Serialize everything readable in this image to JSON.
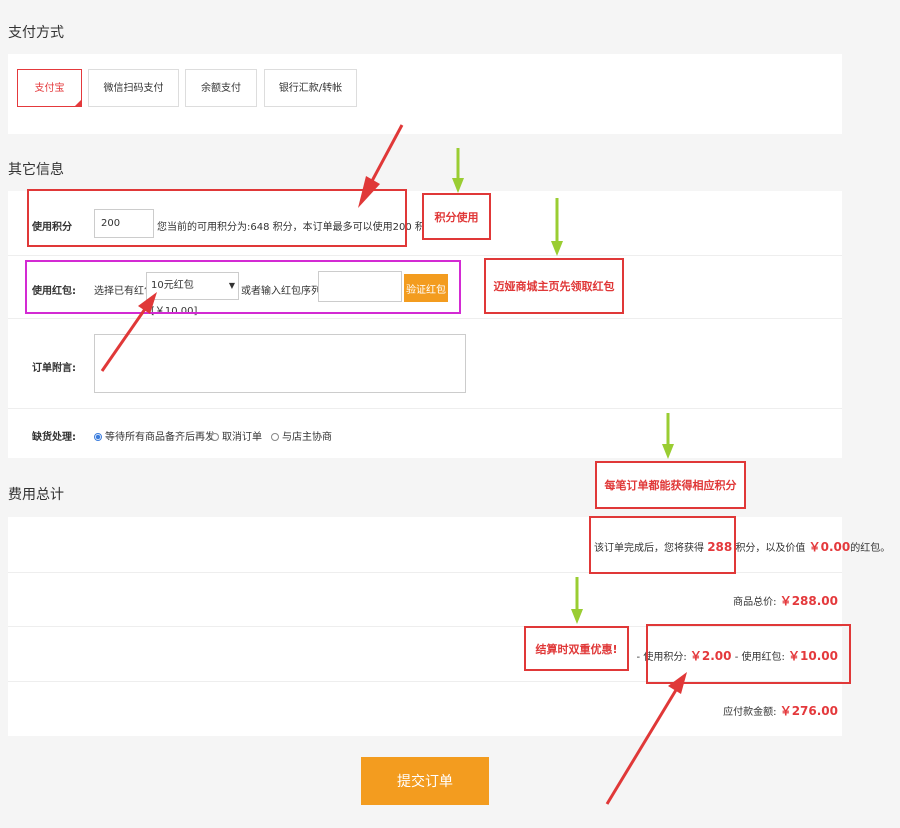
{
  "payment": {
    "title": "支付方式",
    "methods": [
      "支付宝",
      "微信扫码支付",
      "余额支付",
      "银行汇款/转帐"
    ]
  },
  "other": {
    "title": "其它信息",
    "points_label": "使用积分",
    "points_value": "200",
    "points_note": "您当前的可用积分为:648 积分，本订单最多可以使用200 积分.",
    "redpack_label": "使用红包:",
    "redpack_select_text": "选择已有红包",
    "redpack_option": "10元红包[￥10.00]",
    "redpack_or_input": "或者输入红包序列号",
    "verify_button": "验证红包",
    "message_label": "订单附言:",
    "shortage_label": "缺货处理:",
    "shortage_options": [
      "等待所有商品备齐后再发",
      "取消订单",
      "与店主协商"
    ]
  },
  "fees": {
    "title": "费用总计",
    "earn_prefix": "该订单完成后，您将获得",
    "earn_points": "288",
    "earn_mid": "积分，以及价值",
    "earn_value": "￥0.00",
    "earn_suffix": "的红包。",
    "goods_total_label": "商品总价:",
    "goods_total": "￥288.00",
    "discount_points_label": "- 使用积分:",
    "discount_points": "￥2.00",
    "discount_redpack_label": "- 使用红包:",
    "discount_redpack": "￥10.00",
    "payable_label": "应付款金额:",
    "payable": "￥276.00"
  },
  "submit_label": "提交订单",
  "annotations": {
    "points_use": "积分使用",
    "redpack_hint": "迈娅商城主页先领取红包",
    "earn_hint": "每笔订单都能获得相应积分",
    "double_discount": "结算时双重优惠!"
  },
  "colors": {
    "accent_red": "#e4393c",
    "annotation_red": "#e03838",
    "annotation_magenta": "#d32ad3",
    "submit_orange": "#f39c1f",
    "arrow_green": "#9acd32"
  }
}
